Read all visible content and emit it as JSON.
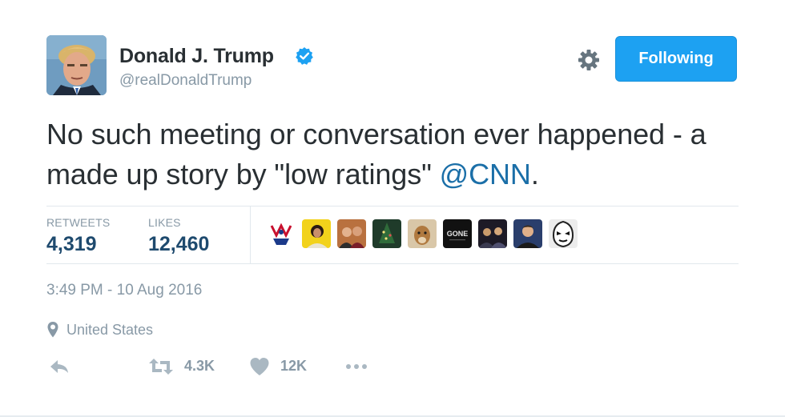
{
  "author": {
    "display_name": "Donald J. Trump",
    "screen_name": "@realDonaldTrump",
    "verified": true
  },
  "follow_button": {
    "label": "Following"
  },
  "tweet": {
    "text_before_mention": "No such meeting or conversation ever happened - a made up story by \"low ratings\" ",
    "mention": "@CNN",
    "text_after_mention": "."
  },
  "stats": {
    "retweets_label": "RETWEETS",
    "retweets_value": "4,319",
    "likes_label": "LIKES",
    "likes_value": "12,460"
  },
  "likers": [
    {
      "name": "liker-avatar-1"
    },
    {
      "name": "liker-avatar-2"
    },
    {
      "name": "liker-avatar-3"
    },
    {
      "name": "liker-avatar-4"
    },
    {
      "name": "liker-avatar-5"
    },
    {
      "name": "liker-avatar-6",
      "text": "GONE"
    },
    {
      "name": "liker-avatar-7"
    },
    {
      "name": "liker-avatar-8"
    },
    {
      "name": "liker-avatar-9"
    }
  ],
  "meta": {
    "timestamp": "3:49 PM - 10 Aug 2016",
    "location": "United States"
  },
  "actions": {
    "retweet_count": "4.3K",
    "like_count": "12K"
  },
  "colors": {
    "accent": "#1da1f2",
    "mention": "#1b6fa8",
    "stat_value": "#1e4a6e",
    "muted": "#8899a6"
  },
  "icons": [
    "verified-badge-icon",
    "gear-icon",
    "location-pin-icon",
    "reply-icon",
    "retweet-icon",
    "heart-icon",
    "more-icon"
  ]
}
